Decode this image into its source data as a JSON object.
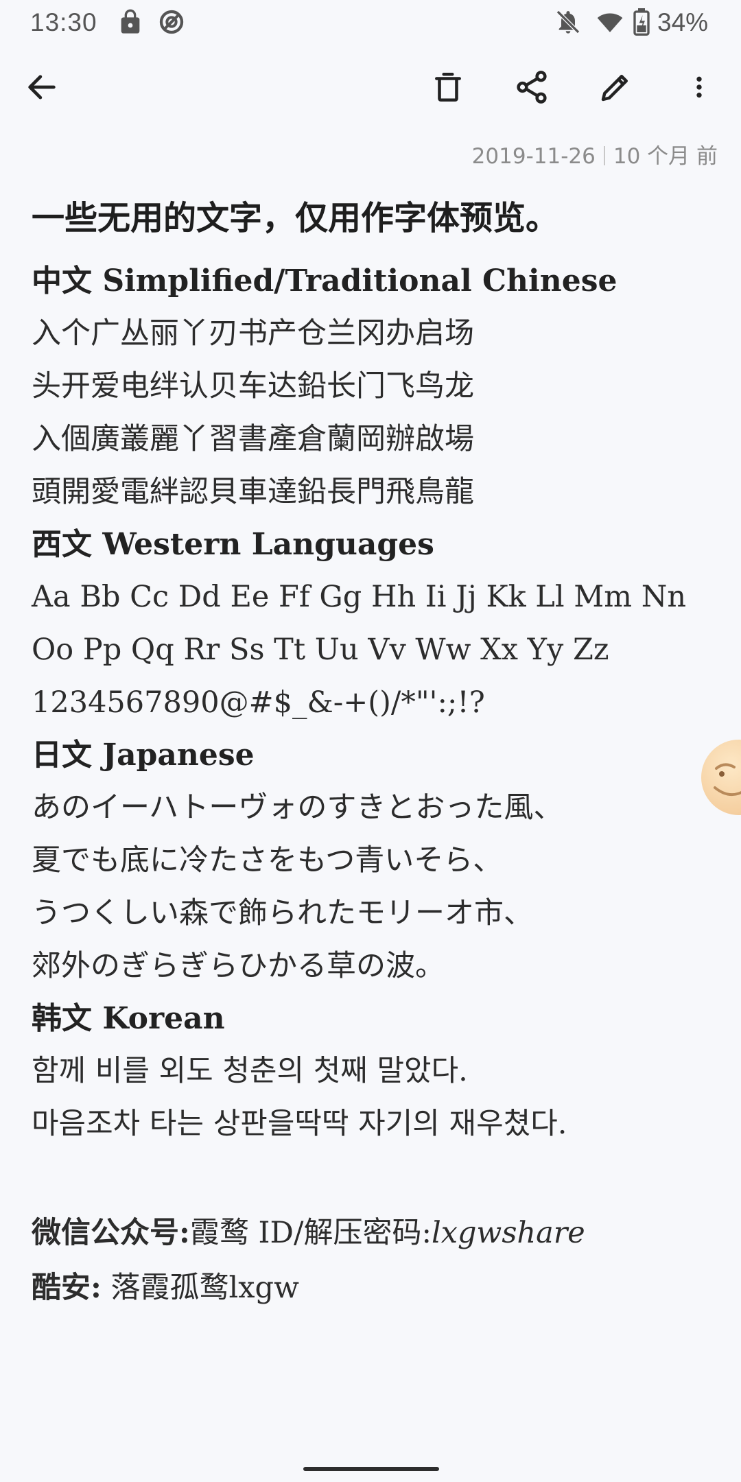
{
  "status_bar": {
    "time": "13:30",
    "battery": "34%",
    "icons": [
      "lock-icon",
      "data-saver-icon",
      "notifications-off-icon",
      "wifi-icon",
      "battery-icon"
    ]
  },
  "toolbar": {
    "icons": [
      "back-arrow-icon",
      "trash-icon",
      "share-icon",
      "edit-pencil-icon",
      "more-vert-icon"
    ]
  },
  "note": {
    "date": "2019-11-26",
    "relative": "10 个月 前",
    "title": "一些无用的文字，仅用作字体预览。",
    "sections": [
      {
        "heading": "中文 Simplified/Traditional Chinese",
        "lines": [
          "入个广丛丽丫刃书产仓兰冈办启场",
          "头开爱电绊认贝车达鉛长门飞鸟龙",
          "入個廣叢麗丫習書產倉蘭岡辦啟場",
          "頭開愛電絆認貝車達鉛長門飛鳥龍"
        ]
      },
      {
        "heading": "西文 Western Languages",
        "lines": [
          "Aa Bb Cc Dd Ee Ff Gg Hh Ii Jj Kk Ll Mm Nn",
          "Oo Pp Qq Rr Ss Tt Uu Vv Ww Xx Yy Zz",
          "1234567890@#$_&-+()/*\"':;!?"
        ]
      },
      {
        "heading": "日文 Japanese",
        "lines": [
          "あのイーハトーヴォのすきとおった風、",
          "夏でも底に冷たさをもつ青いそら、",
          "うつくしい森で飾られたモリーオ市、",
          "郊外のぎらぎらひかる草の波。"
        ]
      },
      {
        "heading": "韩文 Korean",
        "lines": [
          "함께 비를 외도 청춘의 첫째 말았다.",
          "마음조차 타는 상판을딱딱 자기의 재우쳤다."
        ]
      }
    ],
    "footer": {
      "wechat_label": "微信公众号:",
      "wechat_value": "霞鹜 ID/解压密码:",
      "wechat_id": "lxgwshare",
      "coolapk_label": "酷安:",
      "coolapk_value": " 落霞孤鹜lxgw"
    }
  }
}
